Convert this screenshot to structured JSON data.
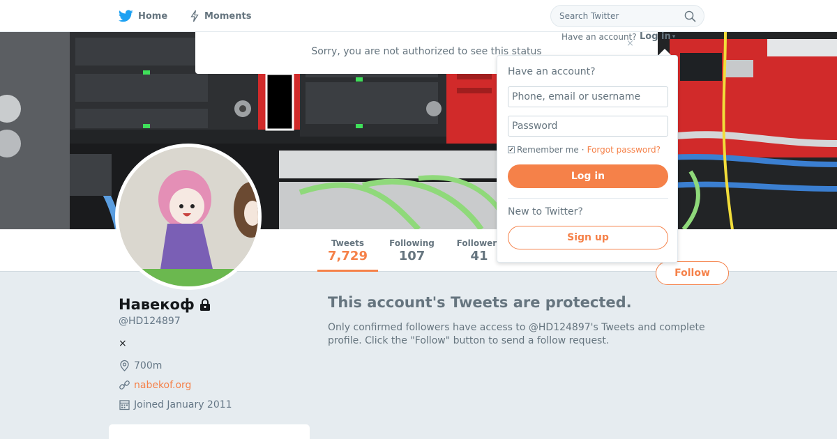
{
  "nav": {
    "home_label": "Home",
    "moments_label": "Moments",
    "search_placeholder": "Search Twitter"
  },
  "notice": {
    "text": "Sorry, you are not authorized to see this status",
    "close_glyph": "×"
  },
  "account_prompt": {
    "have_account": "Have an account?",
    "login_label": "Log in",
    "caret_glyph": "▾"
  },
  "login_dropdown": {
    "heading": "Have an account?",
    "username_placeholder": "Phone, email or username",
    "password_placeholder": "Password",
    "remember_me": "Remember me",
    "separator": "·",
    "forgot_password": "Forgot password?",
    "login_button": "Log in",
    "new_to_twitter": "New to Twitter?",
    "signup_button": "Sign up"
  },
  "profile_nav": {
    "stats": [
      {
        "label": "Tweets",
        "value": "7,729"
      },
      {
        "label": "Following",
        "value": "107"
      },
      {
        "label": "Followers",
        "value": "41"
      }
    ],
    "follow_button": "Follow"
  },
  "profile": {
    "name": "Навекоф",
    "screen_name": "@HD124897",
    "bio": "×",
    "location": "700m",
    "url": "nabekof.org",
    "joined": "Joined January 2011"
  },
  "protected": {
    "title": "This account's Tweets are protected.",
    "text": "Only confirmed followers have access to @HD124897's Tweets and complete profile. Click the \"Follow\" button to send a follow request."
  },
  "colors": {
    "accent": "#f58149",
    "twitter_blue": "#1da1f2",
    "muted_text": "#66757f",
    "page_background": "#e6ecf0"
  }
}
